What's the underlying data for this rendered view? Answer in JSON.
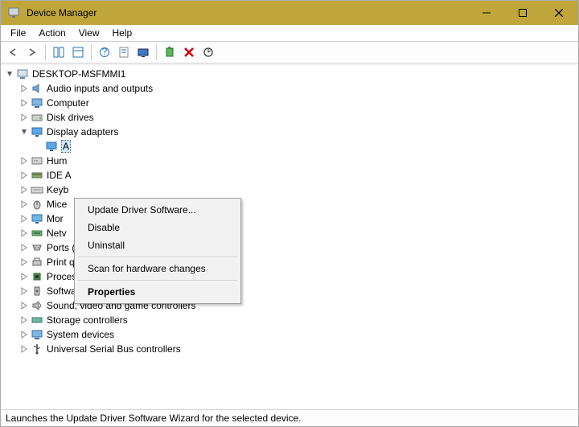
{
  "window": {
    "title": "Device Manager"
  },
  "menu": {
    "file": "File",
    "action": "Action",
    "view": "View",
    "help": "Help"
  },
  "tree": {
    "root": "DESKTOP-MSFMMI1",
    "items": {
      "audio": "Audio inputs and outputs",
      "computer": "Computer",
      "disk": "Disk drives",
      "display": "Display adapters",
      "display_child": "A",
      "hid": "Hum",
      "ide": "IDE A",
      "keyboards": "Keyb",
      "mice": "Mice",
      "monitors": "Mor",
      "network": "Netv",
      "ports": "Ports (COM & LPT)",
      "printq": "Print queues",
      "processors": "Processors",
      "software": "Software devices",
      "sound": "Sound, video and game controllers",
      "storage": "Storage controllers",
      "system": "System devices",
      "usb": "Universal Serial Bus controllers"
    }
  },
  "context_menu": {
    "update": "Update Driver Software...",
    "disable": "Disable",
    "uninstall": "Uninstall",
    "scan": "Scan for hardware changes",
    "properties": "Properties"
  },
  "statusbar": {
    "text": "Launches the Update Driver Software Wizard for the selected device."
  }
}
